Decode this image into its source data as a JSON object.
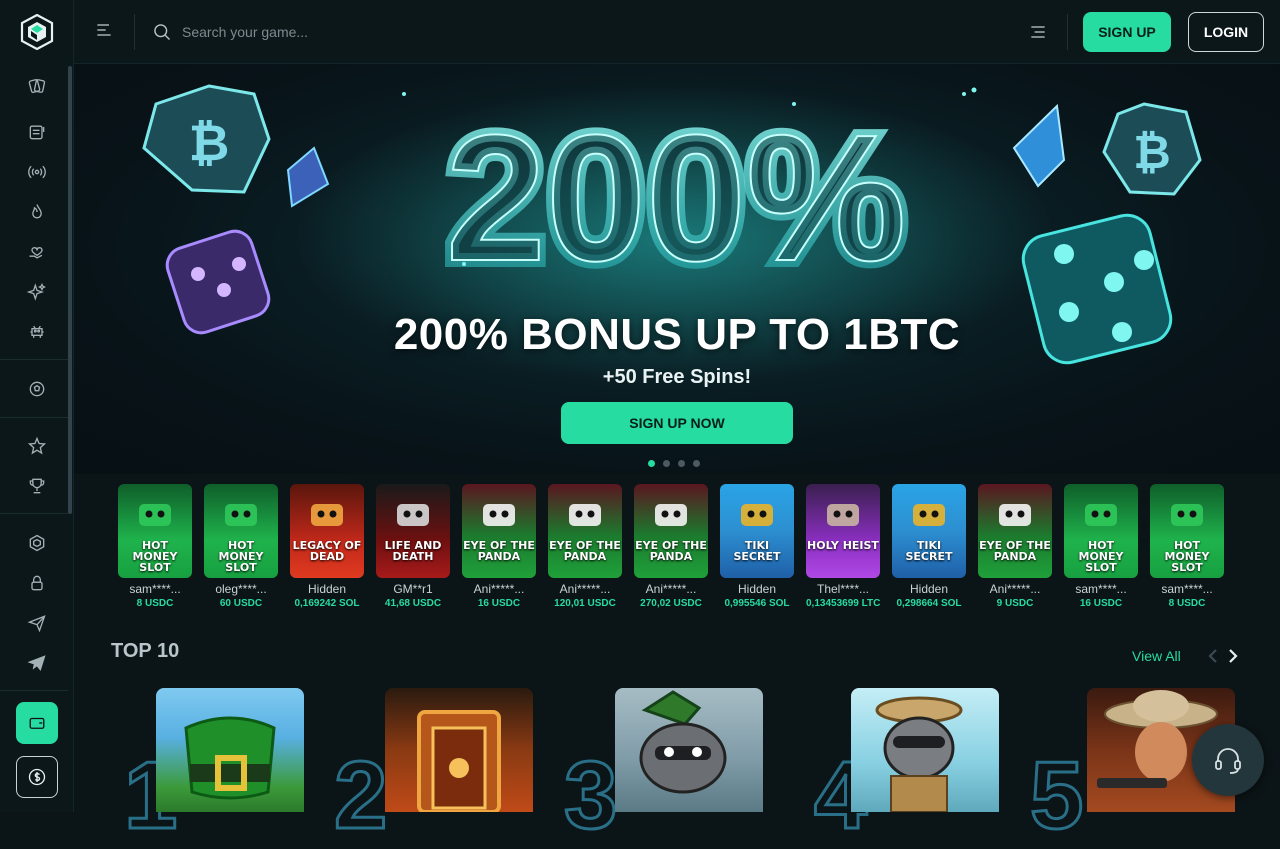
{
  "header": {
    "search_placeholder": "Search your game...",
    "signup_label": "SIGN UP",
    "login_label": "LOGIN"
  },
  "banner": {
    "big_number": "200%",
    "title": "200% BONUS UP TO 1BTC",
    "subtitle": "+50 Free Spins!",
    "cta_label": "SIGN UP NOW",
    "slides": 4,
    "active_slide": 1
  },
  "wins": [
    {
      "game": "HOT MONEY SLOT",
      "user": "sam****...",
      "amount": "8 USDC",
      "theme": "green"
    },
    {
      "game": "HOT MONEY SLOT",
      "user": "oleg****...",
      "amount": "60 USDC",
      "theme": "green"
    },
    {
      "game": "LEGACY OF DEAD",
      "user": "Hidden",
      "amount": "0,169242 SOL",
      "theme": "red"
    },
    {
      "game": "LIFE AND DEATH",
      "user": "GM**r1",
      "amount": "41,68 USDC",
      "theme": "darkred"
    },
    {
      "game": "EYE OF THE PANDA",
      "user": "Ani*****...",
      "amount": "16 USDC",
      "theme": "panda"
    },
    {
      "game": "EYE OF THE PANDA",
      "user": "Ani*****...",
      "amount": "120,01 USDC",
      "theme": "panda"
    },
    {
      "game": "EYE OF THE PANDA",
      "user": "Ani*****...",
      "amount": "270,02 USDC",
      "theme": "panda"
    },
    {
      "game": "TIKI SECRET",
      "user": "Hidden",
      "amount": "0,995546 SOL",
      "theme": "tiki"
    },
    {
      "game": "HOLY HEIST",
      "user": "Thel****...",
      "amount": "0,13453699 LTC",
      "theme": "purple"
    },
    {
      "game": "TIKI SECRET",
      "user": "Hidden",
      "amount": "0,298664 SOL",
      "theme": "tiki"
    },
    {
      "game": "EYE OF THE PANDA",
      "user": "Ani*****...",
      "amount": "9 USDC",
      "theme": "panda"
    },
    {
      "game": "HOT MONEY SLOT",
      "user": "sam****...",
      "amount": "16 USDC",
      "theme": "green"
    },
    {
      "game": "HOT MONEY SLOT",
      "user": "sam****...",
      "amount": "8 USDC",
      "theme": "green"
    }
  ],
  "top10": {
    "title": "TOP 10",
    "view_all": "View All",
    "ranks": [
      "1",
      "2",
      "3",
      "4",
      "5"
    ]
  },
  "colors": {
    "accent": "#27dca0",
    "background": "#0b1416"
  }
}
